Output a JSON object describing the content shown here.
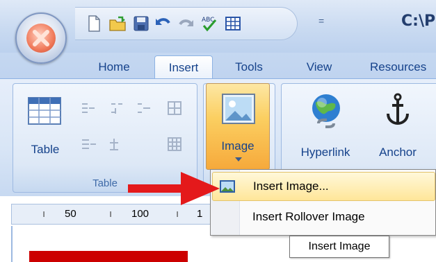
{
  "title_bar": {
    "path_text": "C:\\P",
    "qat_overflow": "="
  },
  "qat_icons": [
    "new-document-icon",
    "open-folder-icon",
    "save-icon",
    "undo-icon",
    "redo-icon",
    "spell-check-icon",
    "table-grid-icon"
  ],
  "tabs": [
    {
      "label": "Home",
      "active": false
    },
    {
      "label": "Insert",
      "active": true
    },
    {
      "label": "Tools",
      "active": false
    },
    {
      "label": "View",
      "active": false
    },
    {
      "label": "Resources",
      "active": false
    }
  ],
  "ribbon": {
    "table_group": {
      "label": "Table",
      "table_button": "Table"
    },
    "image_button": {
      "label": "Image"
    },
    "hyperlink_button": {
      "label": "Hyperlink"
    },
    "anchor_button": {
      "label": "Anchor"
    }
  },
  "ruler": {
    "marks": [
      "50",
      "100",
      "1"
    ]
  },
  "image_menu": {
    "items": [
      {
        "label": "Insert Image...",
        "highlighted": true
      },
      {
        "label": "Insert Rollover Image",
        "highlighted": false
      }
    ]
  },
  "tooltip": {
    "text": "Insert Image"
  },
  "colors": {
    "annotation_arrow": "#e4191b",
    "highlight": "#ffe699",
    "accent": "#15428b"
  }
}
